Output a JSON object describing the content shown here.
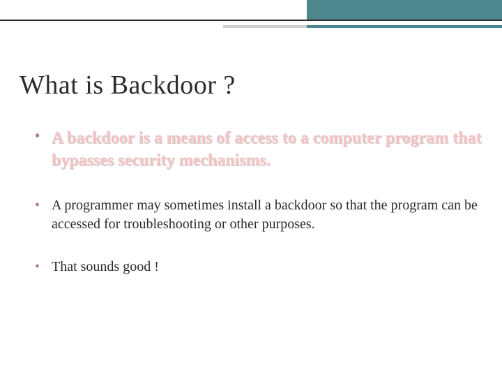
{
  "slide": {
    "title": "What is Backdoor ?",
    "bullets": [
      {
        "text": "A backdoor is a means of access to a computer program that bypasses security mechanisms.",
        "highlight": true
      },
      {
        "text": "A programmer may sometimes install a backdoor so that the program can be accessed for troubleshooting or other purposes.",
        "highlight": false
      },
      {
        "text": "That sounds good !",
        "highlight": false
      }
    ]
  },
  "colors": {
    "accent_teal": "#4d868c",
    "bullet_marker": "#b07aa0",
    "highlight_text": "#f7c3c3"
  }
}
